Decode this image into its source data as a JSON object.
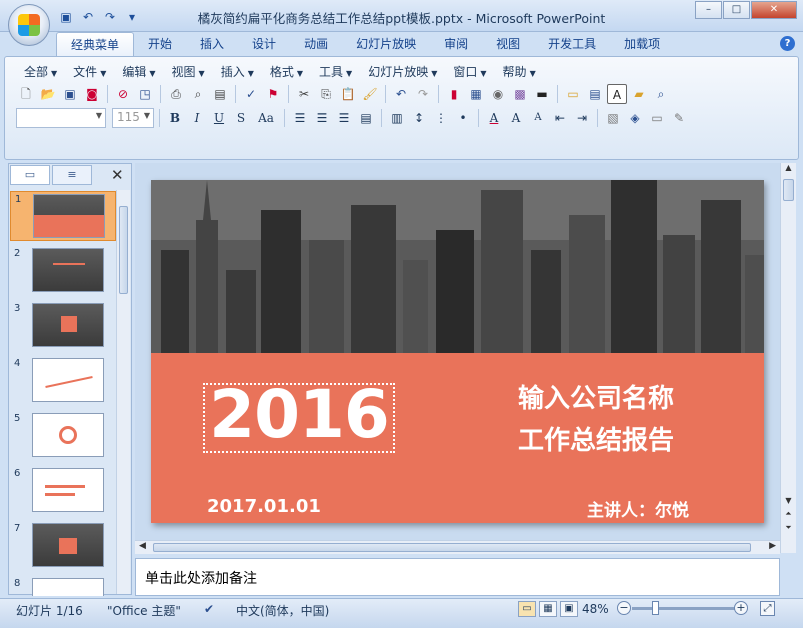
{
  "window": {
    "title": "橘灰简约扁平化商务总结工作总结ppt模板.pptx - Microsoft PowerPoint",
    "controls": [
      "–",
      "□",
      "✕"
    ]
  },
  "qat_icons": [
    "save-icon",
    "undo-icon",
    "redo-icon",
    "customize-icon"
  ],
  "ribbon": {
    "tabs": [
      "经典菜单",
      "开始",
      "插入",
      "设计",
      "动画",
      "幻灯片放映",
      "审阅",
      "视图",
      "开发工具",
      "加载项"
    ],
    "active_tab": "经典菜单",
    "menus": [
      "全部",
      "文件",
      "编辑",
      "视图",
      "插入",
      "格式",
      "工具",
      "幻灯片放映",
      "窗口",
      "帮助"
    ],
    "font_name": "",
    "font_size": "115",
    "row1_icons": [
      "new-icon",
      "open-icon",
      "save-icon",
      "pdf-icon",
      "permission-icon",
      "publish-icon",
      "print-icon",
      "print-preview-icon",
      "spell-icon",
      "research-icon",
      "cut-icon",
      "copy-icon",
      "paste-icon",
      "format-painter-icon",
      "undo-icon",
      "redo-icon",
      "chart-icon",
      "table-icon",
      "clipart-icon",
      "picture-icon",
      "shape-icon",
      "textbox-icon",
      "new-slide-icon",
      "layout-icon",
      "textbox-a-icon",
      "folder-icon",
      "find-icon"
    ],
    "row2_icons": [
      "bold-icon",
      "italic-icon",
      "underline-icon",
      "shadow-icon",
      "change-case-icon",
      "align-left-icon",
      "align-center-icon",
      "align-right-icon",
      "justify-icon",
      "columns-icon",
      "line-spacing-icon",
      "numbering-icon",
      "bullets-icon",
      "font-color-icon",
      "grow-font-icon",
      "shrink-font-icon",
      "decrease-indent-icon",
      "increase-indent-icon",
      "arrange-icon",
      "quick-styles-icon",
      "shape-fill-icon",
      "shape-outline-icon"
    ]
  },
  "slide_pane": {
    "tabs": [
      "slides-tab",
      "outline-tab"
    ],
    "slides": [
      {
        "num": "1",
        "style": "title"
      },
      {
        "num": "2",
        "style": "dark"
      },
      {
        "num": "3",
        "style": "dark"
      },
      {
        "num": "4",
        "style": "light"
      },
      {
        "num": "5",
        "style": "light"
      },
      {
        "num": "6",
        "style": "light"
      },
      {
        "num": "7",
        "style": "dark"
      },
      {
        "num": "8",
        "style": "light"
      }
    ],
    "selected": "1"
  },
  "slide": {
    "year": "2016",
    "company": "输入公司名称",
    "report": "工作总结报告",
    "date": "2017.01.01",
    "speaker": "主讲人：尔悦",
    "accent_color": "#e9735a",
    "photo_color": "#444444"
  },
  "notes": {
    "placeholder": "单击此处添加备注"
  },
  "status": {
    "slide_info": "幻灯片 1/16",
    "theme": "\"Office 主题\"",
    "language": "中文(简体，中国)",
    "zoom": "48%"
  }
}
